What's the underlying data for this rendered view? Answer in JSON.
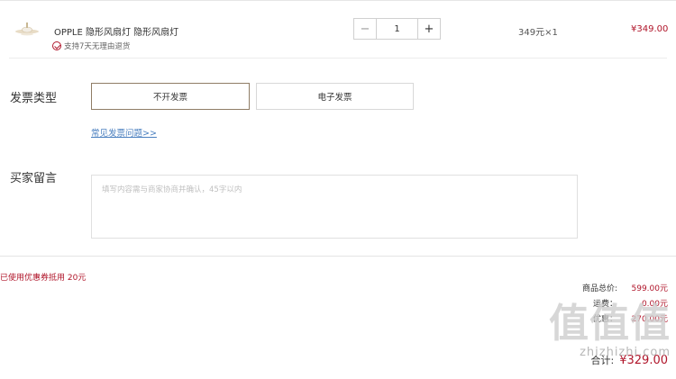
{
  "product": {
    "name": "OPPLE 隐形风扇灯 隐形风扇灯",
    "service": "支持7天无理由退货",
    "quantity": "1",
    "unit_price_text": "349元×1",
    "subtotal": "¥349.00",
    "minus_symbol": "−",
    "plus_symbol": "+"
  },
  "invoice": {
    "label": "发票类型",
    "options": [
      "不开发票",
      "电子发票"
    ],
    "selected": "不开发票",
    "faq_link": "常见发票问题>>"
  },
  "message": {
    "label": "买家留言",
    "placeholder": "填写内容需与商家协商并确认，45字以内"
  },
  "coupon": {
    "text": "已使用优惠券抵用 20元"
  },
  "summary": {
    "goods_total_label": "商品总价:",
    "goods_total_value": "599.00元",
    "shipping_label": "运费：",
    "shipping_value": "0.00元",
    "discount_label": "优惠：",
    "discount_value": "270.00元",
    "total_label": "合计:",
    "total_value": "¥329.00"
  },
  "watermark": {
    "logo_text": "值值值",
    "url": "zhizhizhi.com"
  },
  "colors": {
    "accent_red": "#b0152a",
    "selected_border": "#8f7d66",
    "link_blue": "#4a7fbf"
  },
  "icons": {
    "product_thumbnail": "ceiling-fan-lamp-image",
    "service_check": "check-circle-icon"
  }
}
